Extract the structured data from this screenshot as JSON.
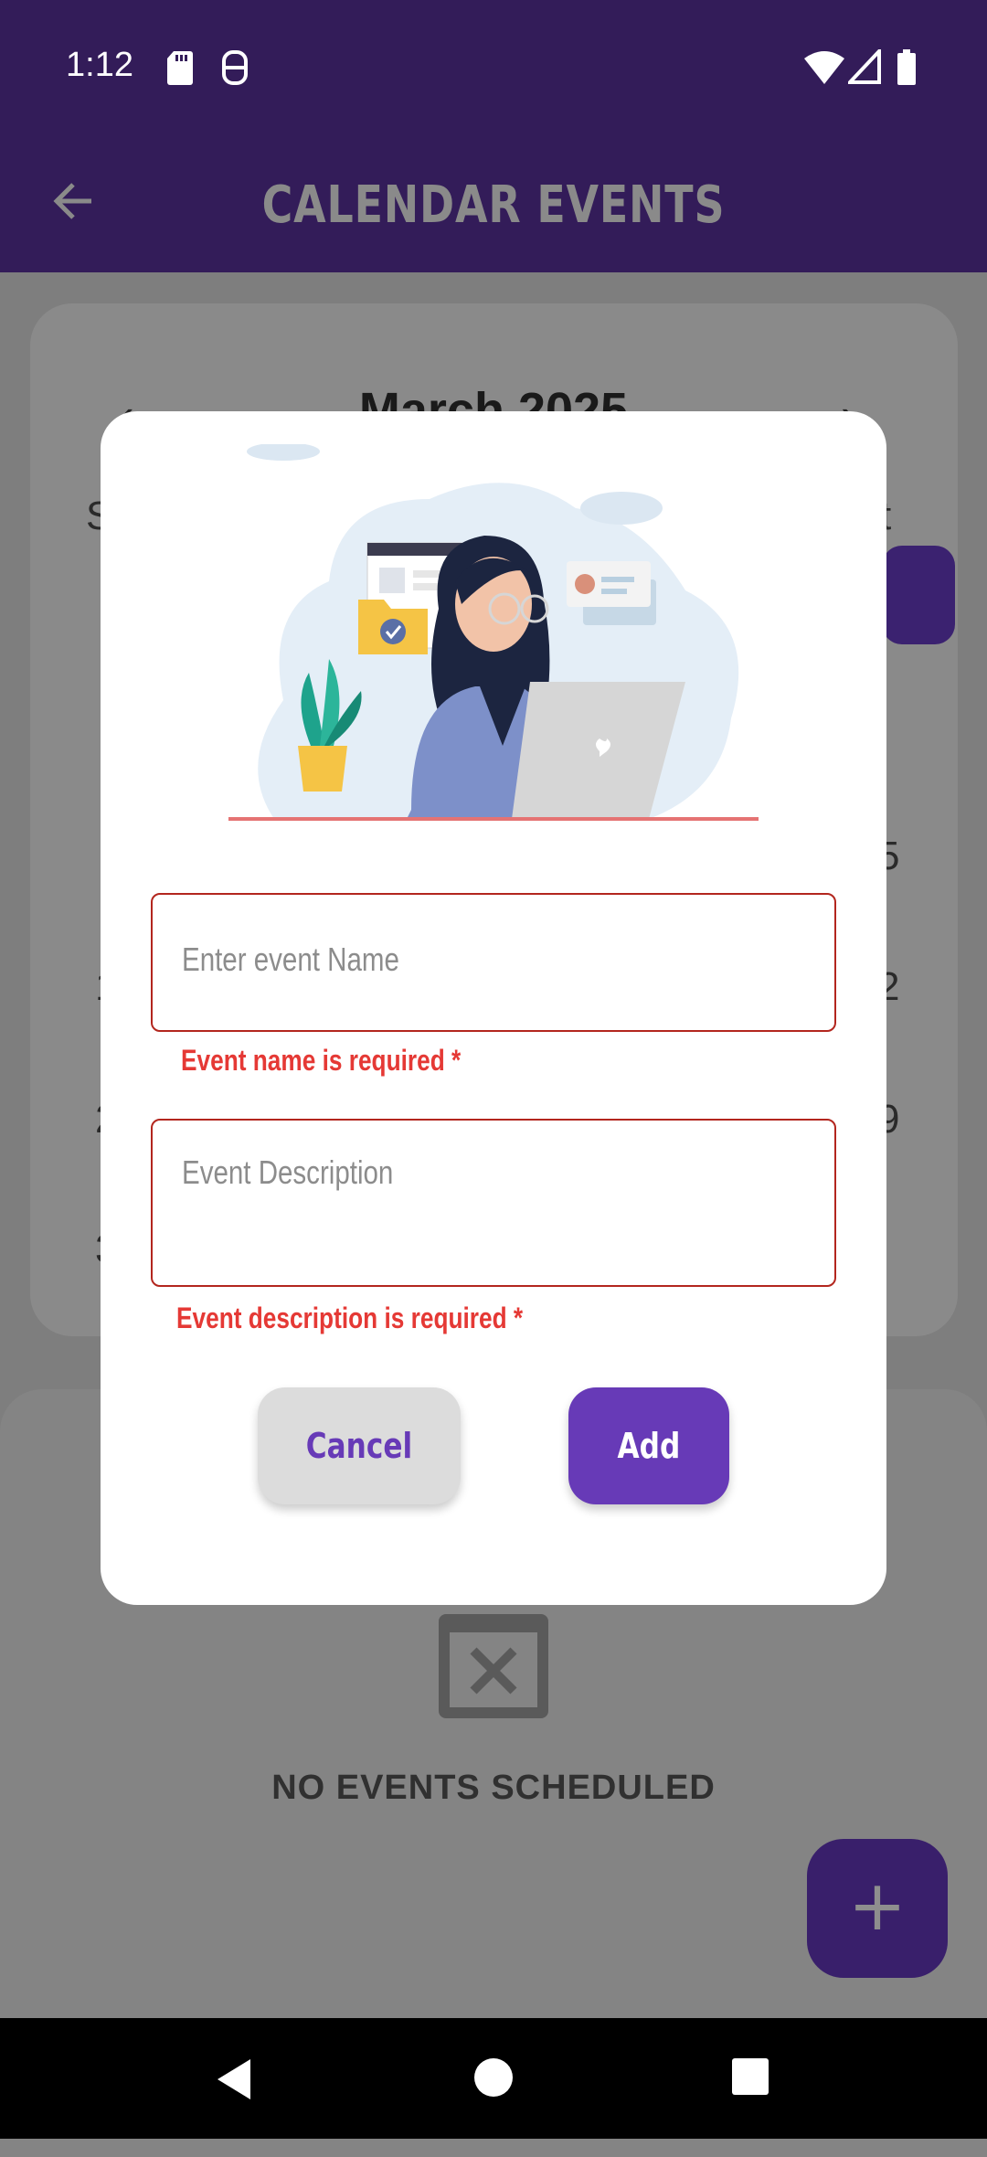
{
  "status_bar": {
    "time": "1:12"
  },
  "app_bar": {
    "title": "CALENDAR EVENTS"
  },
  "calendar": {
    "month": "March 2025",
    "day_fragment_left": "S",
    "day_fragment_right": "t",
    "row_fragments_left": [
      "1",
      "2",
      "3"
    ],
    "row_fragments_right": [
      "5",
      "2",
      "9"
    ]
  },
  "events": {
    "empty_text": "NO EVENTS SCHEDULED"
  },
  "dialog": {
    "name_placeholder": "Enter event Name",
    "name_error": "Event name is required *",
    "description_placeholder": "Event Description",
    "description_error": "Event description is required *",
    "cancel_label": "Cancel",
    "add_label": "Add"
  },
  "colors": {
    "primary": "#673ab7",
    "app_bar": "#331c59",
    "error": "#e53935",
    "error_border": "#b3261e"
  },
  "icons": [
    "sd-card-icon",
    "hanger-icon",
    "wifi-icon",
    "signal-icon",
    "battery-icon",
    "back-arrow-icon",
    "chevron-left-icon",
    "chevron-right-icon",
    "calendar-x-icon",
    "plus-icon",
    "nav-back-icon",
    "nav-home-icon",
    "nav-recents-icon"
  ]
}
